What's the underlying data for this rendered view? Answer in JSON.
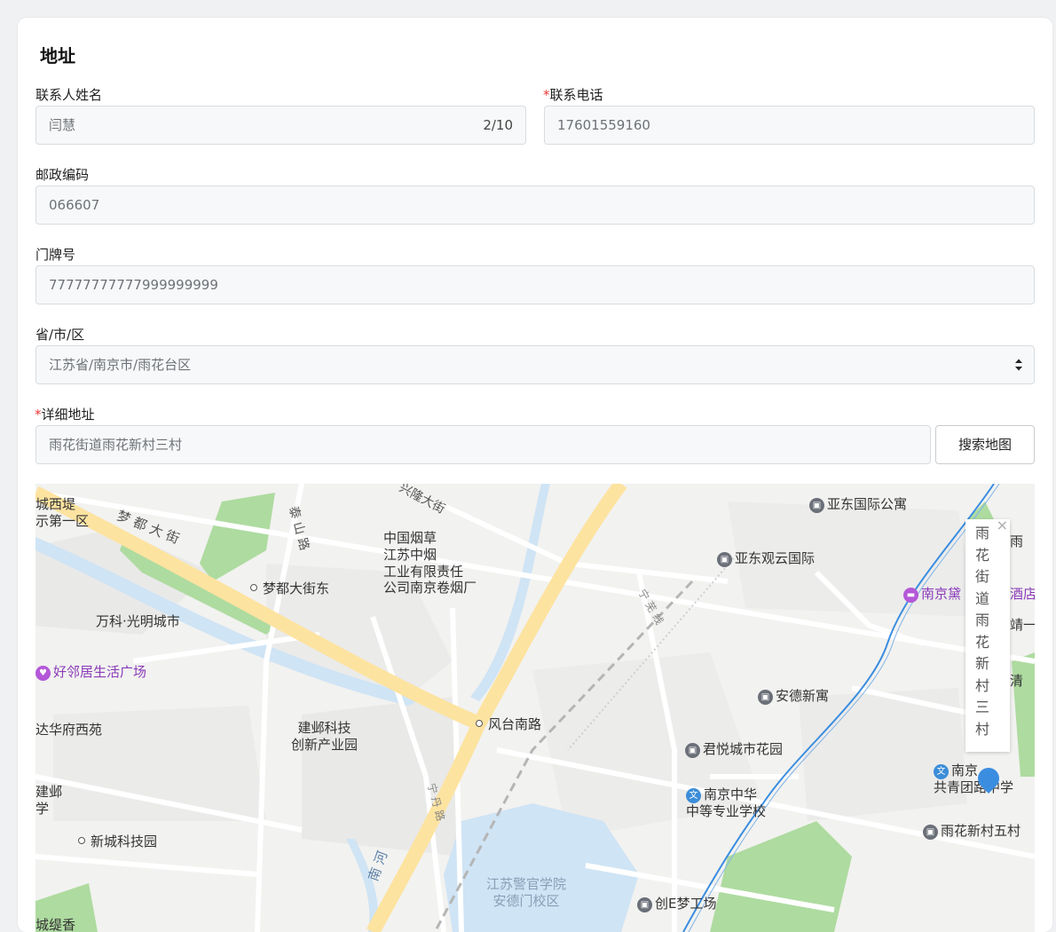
{
  "section": {
    "title": "地址"
  },
  "form": {
    "contact_name": {
      "label": "联系人姓名",
      "value": "闫慧",
      "counter": "2/10"
    },
    "contact_phone": {
      "required_mark": "*",
      "label": "联系电话",
      "value": "17601559160"
    },
    "postal_code": {
      "label": "邮政编码",
      "value": "066607"
    },
    "house_number": {
      "label": "门牌号",
      "value": "77777777777999999999"
    },
    "region": {
      "label": "省/市/区",
      "value": "江苏省/南京市/雨花台区",
      "arrow_icon": "up-down-arrows-icon"
    },
    "detail_address": {
      "required_mark": "*",
      "label": "详细地址",
      "value": "雨花街道雨花新村三村"
    },
    "search_map_button": "搜索地图"
  },
  "map": {
    "colors": {
      "main_road": "#fde3a0",
      "water": "#cfe4f5",
      "green": "#aedba0",
      "metro": "#3b8de0"
    },
    "road_labels": [
      "梦 都 大 街",
      "泰 山 路",
      "宁 芜 线",
      "兴隆大街",
      "南 河",
      "宁 丹 路"
    ],
    "pois": [
      {
        "name": "亚东国际公寓",
        "icon": "building-pin-icon"
      },
      {
        "name": "亚东观云国际",
        "icon": "building-pin-icon"
      },
      {
        "name": "南京黛",
        "icon": "hotel-pin-icon"
      },
      {
        "name": "酒店",
        "icon": ""
      },
      {
        "name": "城西堤",
        "icon": ""
      },
      {
        "name": "示第一区",
        "icon": ""
      },
      {
        "name": "中国烟草\n江苏中烟\n工业有限责任\n公司南京卷烟厂",
        "icon": "dot"
      },
      {
        "name": "梦都大街东",
        "icon": "dot"
      },
      {
        "name": "万科·光明城市",
        "icon": ""
      },
      {
        "name": "好邻居生活广场",
        "icon": "shop-pin-icon"
      },
      {
        "name": "安德新寓",
        "icon": "building-pin-icon"
      },
      {
        "name": "风台南路",
        "icon": "dot"
      },
      {
        "name": "达华府西苑",
        "icon": ""
      },
      {
        "name": "建邺科技\n创新产业园",
        "icon": ""
      },
      {
        "name": "君悦城市花园",
        "icon": "building-pin-icon"
      },
      {
        "name": "南京\n共青团路中学",
        "icon": "school-pin-icon"
      },
      {
        "name": "南京中华\n中等专业学校",
        "icon": "school-pin-icon"
      },
      {
        "name": "雨花新村五村",
        "icon": "building-pin-icon"
      },
      {
        "name": "建邺\n学",
        "icon": ""
      },
      {
        "name": "新城科技园",
        "icon": "dot"
      },
      {
        "name": "江苏警官学院\n安德门校区",
        "icon": ""
      },
      {
        "name": "创E梦工场",
        "icon": "building-pin-icon"
      },
      {
        "name": "城缇香",
        "icon": ""
      },
      {
        "name": "雨",
        "icon": ""
      },
      {
        "name": "靖一",
        "icon": ""
      },
      {
        "name": "清",
        "icon": ""
      }
    ],
    "info_window": {
      "text": "雨花街道雨花新村三村",
      "close": "×"
    },
    "marker": "location-marker-icon"
  }
}
